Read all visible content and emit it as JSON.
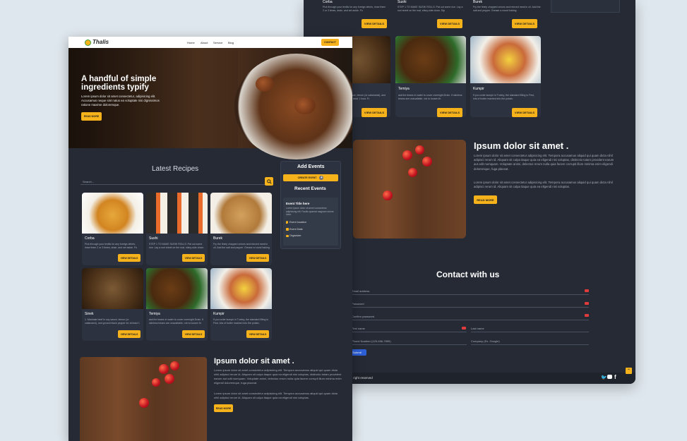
{
  "brand": {
    "name": "Thalis"
  },
  "nav": {
    "items": [
      "Home",
      "About",
      "Service",
      "Blog"
    ],
    "contact_label": "CONTACT"
  },
  "hero": {
    "title_line1": "A handful of simple",
    "title_line2": "ingredients typify",
    "text": "Lorem ipsum dolor sit amet consectetur, adipisicing elit. Accusamus neque sint natus ea voluptate nisi dignissimos ratione maxime doloremque.",
    "button": "READ MORE"
  },
  "recipes": {
    "title": "Latest Recipes",
    "search_placeholder": "Search...",
    "button_label": "VIEW DETAILS",
    "items": [
      {
        "name": "Corba",
        "desc": "Pick through your lentils for any foreign debris, rinse them 2 or 3 times, drain, and set aside. Fo"
      },
      {
        "name": "Sushi",
        "desc": "STEP 1 TO MAKE SUSHI ROLLS: Pat out some rice. Lay a nori sheet on the mat, shiny-side down. Dip"
      },
      {
        "name": "Burek",
        "desc": "Fry the finely chopped onions and minced meat in oil. Add the salt and pepper. Grease a round baking"
      },
      {
        "name": "Sinek",
        "desc": "1. Marinate beef in soy sauce, lemon (or calamansi), and ground black pepper for at least 1 hour. Fr"
      },
      {
        "name": "Temiya",
        "desc": "ask the beans in water to cover overnight.Drain. If skinless beans are unavailable, rub to loosen th"
      },
      {
        "name": "Kumpir",
        "desc": "If you order kumpir in Turkey, the standard filling is First, lots of butter mashed into the potato."
      }
    ]
  },
  "sidebar": {
    "add_events_title": "Add Events",
    "create_event": "CREATE EVENT",
    "recent_events_title": "Recent Events",
    "event_title": "Event Title here",
    "event_desc": "Lorem ipsum dolor sit amet consectetur adipisicing elit. Facilis quaerat magnam dolore dolor.",
    "event_location": "Event location",
    "event_date": "Event Date",
    "event_organizer": "Organizer"
  },
  "about": {
    "title": "Ipsum dolor sit amet .",
    "p1": "Lorem ipsum dolor sit amet consectetur adipisicing elit. Tempora accusamus aliquid qui quam dicta nihil adipisci rerum id. Aliquam sit culpa itaque quia ea eligendi nisi voluptas, distinctio totam provident earum aut odit numquam. Voluptate animi, delectus rerum nulla quia facere corrupti illum minima enim eligendi doloremque, fuga placeat.",
    "p2": "Lorem ipsum dolor sit amet consectetur adipisicing elit. Tempora accusamus aliquid qui quam dicta nihil adipisci rerum id. Aliquam sit culpa itaque quia ea eligendi nisi voluptas.",
    "button": "READ MORE"
  },
  "contact": {
    "title": "Contact with us",
    "email_label": "Email address",
    "password_label": "Password",
    "confirm_label": "Confirm password",
    "first_name": "First name",
    "last_name": "Last name",
    "phone": "Phone Number (123-456-7890)",
    "company": "Company (Ex. Google)",
    "submit": "Submit"
  },
  "footer": {
    "copyright": "All right reserved"
  },
  "colors": {
    "bg": "#dfe7ee",
    "panel": "#252a35",
    "accent": "#f6b21b"
  }
}
